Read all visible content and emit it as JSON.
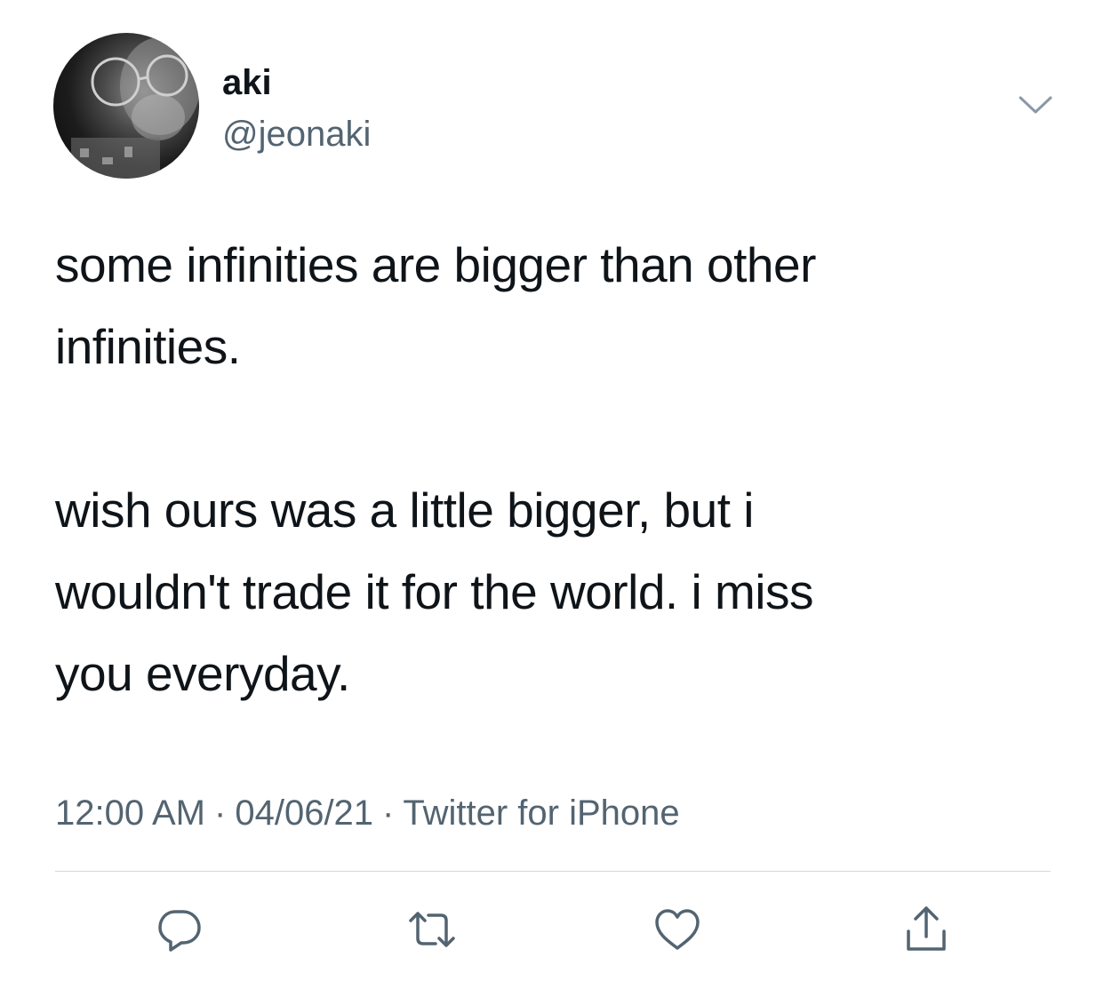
{
  "author": {
    "display_name": "aki",
    "handle": "@jeonaki"
  },
  "tweet": {
    "lines": [
      "some infinities are bigger than other",
      "infinities.",
      "",
      "wish ours was a little bigger, but i",
      "wouldn't trade it for the world. i miss",
      "you everyday."
    ]
  },
  "meta": {
    "time": "12:00 AM",
    "separator": "·",
    "date": "04/06/21",
    "source": "Twitter for iPhone"
  },
  "actions": [
    "reply-icon",
    "retweet-icon",
    "like-icon",
    "share-icon"
  ],
  "colors": {
    "text": "#0f1419",
    "secondary": "#536471",
    "divider": "#cfd9de",
    "icon": "#536471"
  }
}
